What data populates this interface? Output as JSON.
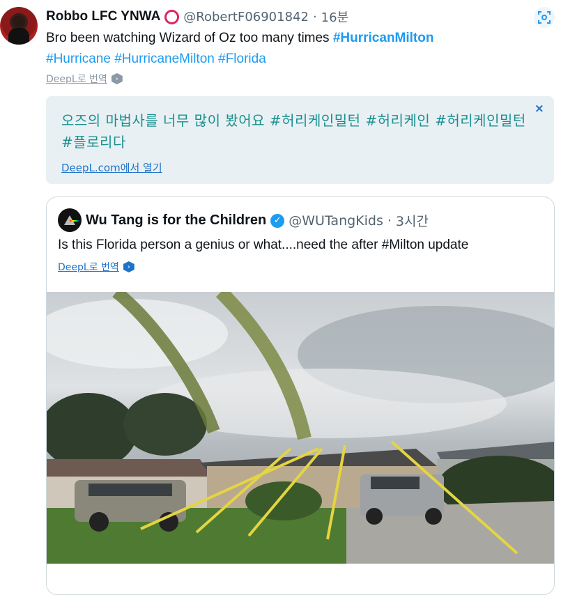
{
  "tweet": {
    "author_name": "Robbo LFC YNWA",
    "handle": "@RobertF06901842",
    "time": "16분",
    "text_plain": "Bro been watching Wizard of Oz too many times ",
    "hashtags": [
      "#HurricanMilton",
      "#Hurricane",
      "#HurricaneMilton",
      "#Florida"
    ],
    "deepl_link": "DeepL로 번역"
  },
  "translation": {
    "text": "오즈의 마법사를 너무 많이 봤어요 #허리케인밀턴 #허리케인 #허리케인밀턴 #플로리다",
    "open_link": "DeepL.com에서 열기",
    "close_label": "×"
  },
  "quoted": {
    "author_name": "Wu Tang is for the Children",
    "handle": "@WUTangKids",
    "time": "3시간",
    "text": "Is this Florida person a genius or what....need the after #Milton update",
    "deepl_link": "DeepL로 번역"
  },
  "colors": {
    "link": "#1d9bf0",
    "deepl_blue": "#1d73c9",
    "translation_bg": "#e8f0f3",
    "translation_text": "#1a8f8f"
  },
  "icons": [
    "scan-icon",
    "deepl-icon",
    "verified-badge-icon",
    "close-icon"
  ]
}
